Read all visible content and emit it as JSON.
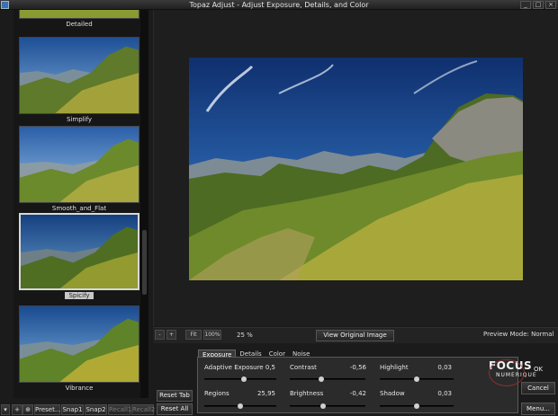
{
  "window": {
    "title": "Topaz Adjust - Adjust Exposure, Details, and Color",
    "controls": [
      "_",
      "□",
      "×"
    ]
  },
  "presets": [
    {
      "label": "Detailed"
    },
    {
      "label": "Simplify"
    },
    {
      "label": "Smooth_and_Flat"
    },
    {
      "label": "Spicify",
      "selected": true
    },
    {
      "label": "Vibrance"
    }
  ],
  "zoom": {
    "minus": "-",
    "plus": "+",
    "fit": "Fit",
    "hundred": "100%",
    "current": "25 %"
  },
  "view_original": "View Original Image",
  "preview_mode": "Preview Mode:  Normal",
  "bottom_buttons": {
    "add": "+",
    "preset": "Preset...",
    "snap1": "Snap1",
    "snap2": "Snap2",
    "recall1": "Recall1",
    "recall2": "Recall2"
  },
  "reset_tab": "Reset Tab",
  "reset_all": "Reset All",
  "tabs": [
    "Exposure",
    "Details",
    "Color",
    "Noise"
  ],
  "sliders": {
    "adaptive_exposure": {
      "label": "Adaptive Exposure",
      "value": "0,5",
      "pos": 0.55
    },
    "contrast": {
      "label": "Contrast",
      "value": "-0,56",
      "pos": 0.42
    },
    "highlight": {
      "label": "Highlight",
      "value": "0,03",
      "pos": 0.5
    },
    "regions": {
      "label": "Regions",
      "value": "25,95",
      "pos": 0.5
    },
    "brightness": {
      "label": "Brightness",
      "value": "-0,42",
      "pos": 0.44
    },
    "shadow": {
      "label": "Shadow",
      "value": "0,03",
      "pos": 0.5
    }
  },
  "right_buttons": {
    "ok": "OK",
    "cancel": "Cancel",
    "menu": "Menu..."
  },
  "watermark": {
    "line1": "FOCUS",
    "line2": "NUMERIQUE"
  },
  "colors": {
    "sky": "#1d4f9a",
    "grass": "#6b8a2c"
  }
}
